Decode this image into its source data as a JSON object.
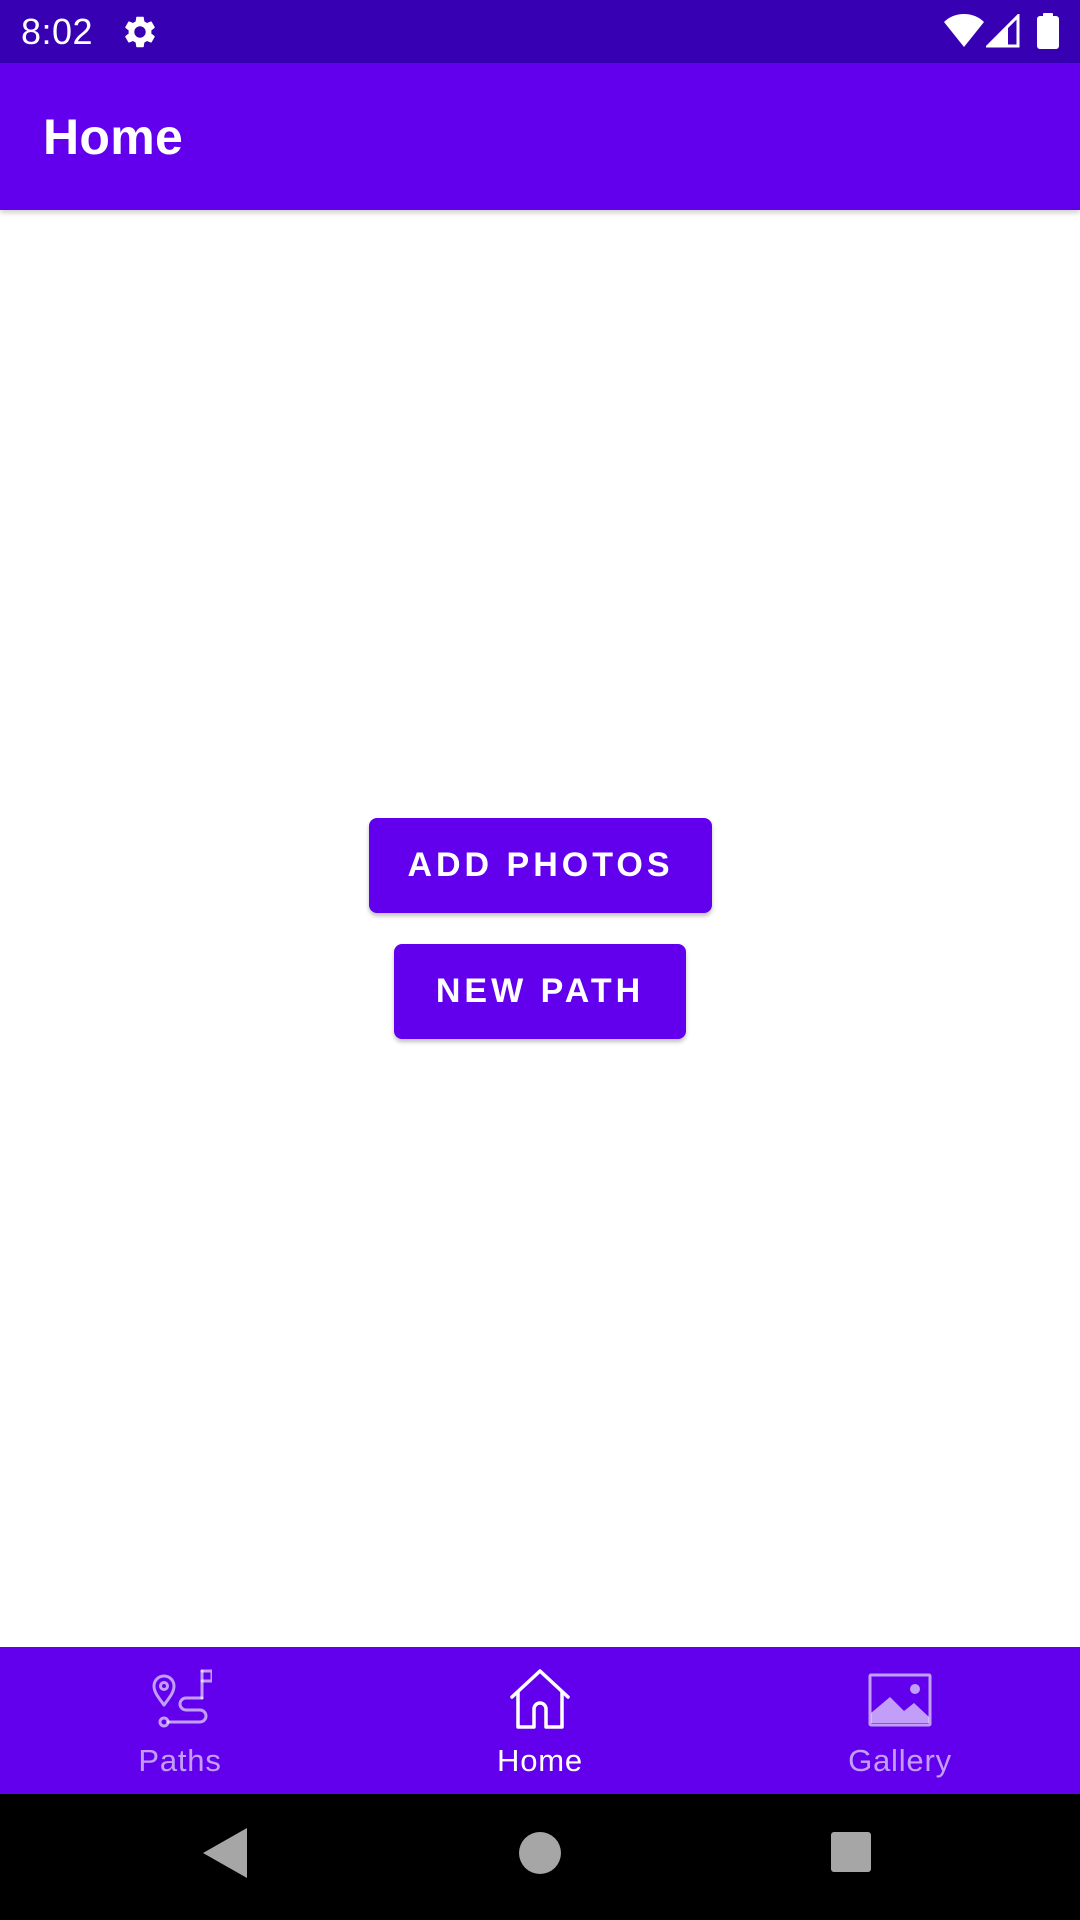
{
  "status_bar": {
    "time": "8:02",
    "icons": [
      "gear-icon",
      "wifi-icon",
      "signal-icon",
      "battery-icon"
    ]
  },
  "app_bar": {
    "title": "Home"
  },
  "main": {
    "add_photos_label": "ADD PHOTOS",
    "new_path_label": "NEW PATH"
  },
  "bottom_nav": {
    "items": [
      {
        "label": "Paths",
        "icon": "route-icon",
        "active": false
      },
      {
        "label": "Home",
        "icon": "home-icon",
        "active": true
      },
      {
        "label": "Gallery",
        "icon": "image-icon",
        "active": false
      }
    ]
  },
  "system_nav": {
    "icons": [
      "back-icon",
      "home-circle-icon",
      "recents-icon"
    ]
  },
  "colors": {
    "status_bar": "#3700b3",
    "primary": "#6200ee",
    "on_primary": "#ffffff",
    "background": "#ffffff",
    "system_nav": "#000000"
  }
}
